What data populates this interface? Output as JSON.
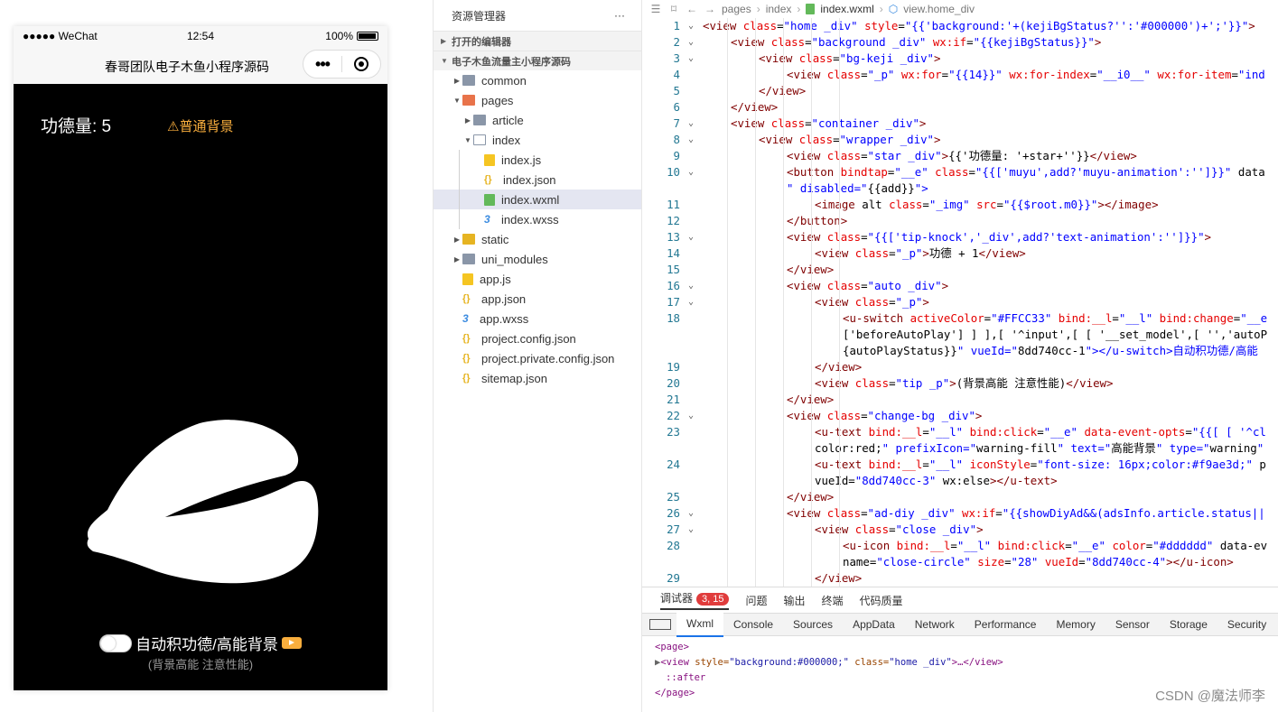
{
  "simulator": {
    "status_left": "●●●●● WeChat",
    "time": "12:54",
    "battery": "100%",
    "nav_title": "春哥团队电子木鱼小程序源码",
    "merit_text": "功德量: 5",
    "bg_switch_text": "⚠普通背景",
    "auto_text": "自动积功德/高能背景",
    "tip_text": "(背景高能 注意性能)",
    "accent_color": "#f9ae3d",
    "background_color": "#000000"
  },
  "explorer": {
    "title": "资源管理器",
    "more": "···",
    "section_open_editors": "打开的编辑器",
    "section_project": "电子木鱼流量主小程序源码",
    "items": [
      {
        "label": "common",
        "icon": "folder-icon"
      },
      {
        "label": "pages",
        "icon": "pages-folder-icon"
      },
      {
        "label": "article",
        "icon": "folder-icon"
      },
      {
        "label": "index",
        "icon": "folder-open-icon"
      },
      {
        "label": "index.js",
        "icon": "js-file-icon"
      },
      {
        "label": "index.json",
        "icon": "json-file-icon"
      },
      {
        "label": "index.wxml",
        "icon": "wxml-file-icon"
      },
      {
        "label": "index.wxss",
        "icon": "wxss-file-icon"
      },
      {
        "label": "static",
        "icon": "static-folder-icon"
      },
      {
        "label": "uni_modules",
        "icon": "folder-icon"
      },
      {
        "label": "app.js",
        "icon": "js-file-icon"
      },
      {
        "label": "app.json",
        "icon": "json-file-icon"
      },
      {
        "label": "app.wxss",
        "icon": "wxss-file-icon"
      },
      {
        "label": "project.config.json",
        "icon": "json-file-icon"
      },
      {
        "label": "project.private.config.json",
        "icon": "json-file-icon"
      },
      {
        "label": "sitemap.json",
        "icon": "json-file-icon"
      }
    ]
  },
  "editor": {
    "breadcrumb": [
      "pages",
      "index",
      "index.wxml",
      "view.home_div"
    ],
    "lines": [
      {
        "n": "1",
        "fold": "⌄",
        "indent": 0,
        "code": "<view class=\"home _div\" style=\"{{'background:'+(kejiBgStatus?'':'#000000')+';'}}\">"
      },
      {
        "n": "2",
        "fold": "⌄",
        "indent": 1,
        "code": "<view class=\"background _div\" wx:if=\"{{kejiBgStatus}}\">"
      },
      {
        "n": "3",
        "fold": "⌄",
        "indent": 2,
        "code": "<view class=\"bg-keji _div\">"
      },
      {
        "n": "4",
        "fold": "",
        "indent": 3,
        "code": "<view class=\"_p\" wx:for=\"{{14}}\" wx:for-index=\"__i0__\" wx:for-item=\"ind"
      },
      {
        "n": "5",
        "fold": "",
        "indent": 2,
        "code": "</view>"
      },
      {
        "n": "6",
        "fold": "",
        "indent": 1,
        "code": "</view>"
      },
      {
        "n": "7",
        "fold": "⌄",
        "indent": 1,
        "code": "<view class=\"container _div\">"
      },
      {
        "n": "8",
        "fold": "⌄",
        "indent": 2,
        "code": "<view class=\"wrapper _div\">"
      },
      {
        "n": "9",
        "fold": "",
        "indent": 3,
        "code": "<view class=\"star _div\">{{'功德量: '+star+''}}</view>"
      },
      {
        "n": "10",
        "fold": "⌄",
        "indent": 3,
        "code": "<button bindtap=\"__e\" class=\"{{['muyu',add?'muyu-animation':'']}}\" data"
      },
      {
        "n": "",
        "fold": "",
        "indent": 3,
        "code": "\" disabled=\"{{add}}\">"
      },
      {
        "n": "11",
        "fold": "",
        "indent": 4,
        "code": "<image alt class=\"_img\" src=\"{{$root.m0}}\"></image>"
      },
      {
        "n": "12",
        "fold": "",
        "indent": 3,
        "code": "</button>"
      },
      {
        "n": "13",
        "fold": "⌄",
        "indent": 3,
        "code": "<view class=\"{{['tip-knock','_div',add?'text-animation':'']}}\">"
      },
      {
        "n": "14",
        "fold": "",
        "indent": 4,
        "code": "<view class=\"_p\">功德 + 1</view>"
      },
      {
        "n": "15",
        "fold": "",
        "indent": 3,
        "code": "</view>"
      },
      {
        "n": "16",
        "fold": "⌄",
        "indent": 3,
        "code": "<view class=\"auto _div\">"
      },
      {
        "n": "17",
        "fold": "⌄",
        "indent": 4,
        "code": "<view class=\"_p\">"
      },
      {
        "n": "18",
        "fold": "",
        "indent": 5,
        "code": "<u-switch activeColor=\"#FFCC33\" bind:__l=\"__l\" bind:change=\"__e"
      },
      {
        "n": "",
        "fold": "",
        "indent": 5,
        "code": "['beforeAutoPlay'] ] ],[ '^input',[ [ '__set_model',[ '','autoP"
      },
      {
        "n": "",
        "fold": "",
        "indent": 5,
        "code": "{autoPlayStatus}}\" vueId=\"8dd740cc-1\"></u-switch>自动积功德/高能"
      },
      {
        "n": "19",
        "fold": "",
        "indent": 4,
        "code": "</view>"
      },
      {
        "n": "20",
        "fold": "",
        "indent": 4,
        "code": "<view class=\"tip _p\">(背景高能 注意性能)</view>"
      },
      {
        "n": "21",
        "fold": "",
        "indent": 3,
        "code": "</view>"
      },
      {
        "n": "22",
        "fold": "⌄",
        "indent": 3,
        "code": "<view class=\"change-bg _div\">"
      },
      {
        "n": "23",
        "fold": "",
        "indent": 4,
        "code": "<u-text bind:__l=\"__l\" bind:click=\"__e\" data-event-opts=\"{{[ [ '^cl"
      },
      {
        "n": "",
        "fold": "",
        "indent": 4,
        "code": "color:red;\" prefixIcon=\"warning-fill\" text=\"高能背景\" type=\"warning\""
      },
      {
        "n": "24",
        "fold": "",
        "indent": 4,
        "code": "<u-text bind:__l=\"__l\" iconStyle=\"font-size: 16px;color:#f9ae3d;\" p"
      },
      {
        "n": "",
        "fold": "",
        "indent": 4,
        "code": "vueId=\"8dd740cc-3\" wx:else></u-text>"
      },
      {
        "n": "25",
        "fold": "",
        "indent": 3,
        "code": "</view>"
      },
      {
        "n": "26",
        "fold": "⌄",
        "indent": 3,
        "code": "<view class=\"ad-diy _div\" wx:if=\"{{showDiyAd&&(adsInfo.article.status||"
      },
      {
        "n": "27",
        "fold": "⌄",
        "indent": 4,
        "code": "<view class=\"close _div\">"
      },
      {
        "n": "28",
        "fold": "",
        "indent": 5,
        "code": "<u-icon bind:__l=\"__l\" bind:click=\"__e\" color=\"#dddddd\" data-ev"
      },
      {
        "n": "",
        "fold": "",
        "indent": 5,
        "code": "name=\"close-circle\" size=\"28\" vueId=\"8dd740cc-4\"></u-icon>"
      },
      {
        "n": "29",
        "fold": "",
        "indent": 4,
        "code": "</view>"
      }
    ]
  },
  "debugger": {
    "tabs": [
      "调试器",
      "问题",
      "输出",
      "终端",
      "代码质量"
    ],
    "badge": "3, 15",
    "devtools_tabs": [
      "Wxml",
      "Console",
      "Sources",
      "AppData",
      "Network",
      "Performance",
      "Memory",
      "Sensor",
      "Storage",
      "Security"
    ],
    "tree": {
      "line1": "<page>",
      "line2_tag": "<view",
      "line2_attr1": " style=",
      "line2_val1": "\"background:#000000;\"",
      "line2_attr2": " class=",
      "line2_val2": "\"home _div\"",
      "line2_end": ">…</view>",
      "line3": "::after",
      "line4": "</page>"
    }
  },
  "watermark": "CSDN @魔法师李"
}
